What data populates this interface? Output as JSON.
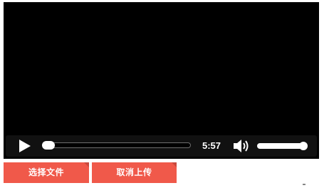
{
  "player": {
    "time_display": "5:57",
    "progress_fraction": 0.03,
    "volume_fraction": 1.0,
    "icons": {
      "play": "play-icon",
      "volume": "volume-icon"
    }
  },
  "actions": {
    "select_file_label": "选择文件",
    "cancel_upload_label": "取消上传"
  },
  "colors": {
    "button_bg": "#f0594a",
    "player_bg": "#000000",
    "controls_bg": "#111111"
  }
}
